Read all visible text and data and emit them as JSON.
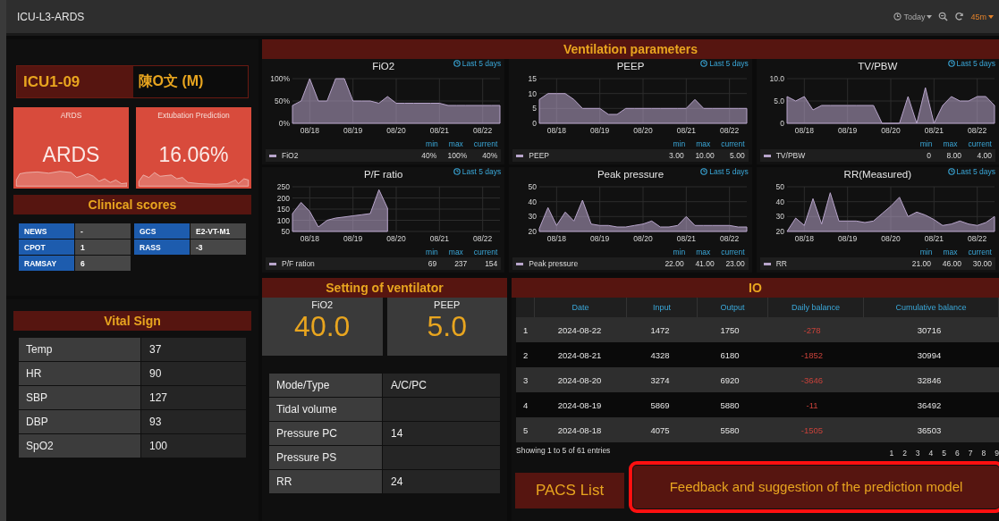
{
  "top_bar": {
    "title": "ICU-L3-ARDS",
    "time_range": "Today",
    "refresh_interval": "45m"
  },
  "patient": {
    "bed": "ICU1-09",
    "name": "陳O文 (M)"
  },
  "prediction_cards": [
    {
      "title": "ARDS",
      "value": "ARDS"
    },
    {
      "title": "Extubation Prediction",
      "value": "16.06%"
    }
  ],
  "clinical_scores": {
    "title": "Clinical scores",
    "items": [
      {
        "label": "NEWS",
        "value": "-"
      },
      {
        "label": "GCS",
        "value": "E2-VT-M1"
      },
      {
        "label": "CPOT",
        "value": "1"
      },
      {
        "label": "RASS",
        "value": "-3"
      },
      {
        "label": "RAMSAY",
        "value": "6"
      }
    ]
  },
  "vital_sign": {
    "title": "Vital Sign",
    "rows": [
      {
        "label": "Temp",
        "value": "37"
      },
      {
        "label": "HR",
        "value": "90"
      },
      {
        "label": "SBP",
        "value": "127"
      },
      {
        "label": "DBP",
        "value": "93"
      },
      {
        "label": "SpO2",
        "value": "100"
      }
    ]
  },
  "ventilation_parameters": {
    "title": "Ventilation parameters",
    "panels": [
      {
        "title": "FiO2",
        "range": "Last 5 days",
        "legend_headers": [
          "min",
          "max",
          "current"
        ],
        "legend": {
          "min": "40%",
          "max": "100%",
          "current": "40%"
        },
        "chart_data": {
          "grid": true,
          "type": "area",
          "categories": [
            null,
            null,
            "08/18",
            null,
            null,
            null,
            null,
            "08/19",
            null,
            null,
            null,
            null,
            "08/20",
            null,
            null,
            null,
            null,
            "08/21",
            null,
            null,
            null,
            null,
            "08/22",
            null,
            null
          ],
          "series": [
            {
              "name": "FiO2",
              "color": "#b9a6cc",
              "values": [
                40,
                50,
                100,
                50,
                50,
                100,
                100,
                50,
                50,
                50,
                45,
                60,
                45,
                45,
                45,
                45,
                45,
                45,
                40,
                40,
                40,
                40,
                40,
                40,
                40
              ]
            }
          ],
          "ylim": [
            0,
            100
          ],
          "yticks": [
            {
              "value": 0,
              "label": "0%"
            },
            {
              "value": 50,
              "label": "50%"
            },
            {
              "value": 100,
              "label": "100%"
            }
          ]
        }
      },
      {
        "title": "PEEP",
        "range": "Last 5 days",
        "legend_headers": [
          "min",
          "max",
          "current"
        ],
        "legend": {
          "min": "3.00",
          "max": "10.00",
          "current": "5.00"
        },
        "chart_data": {
          "grid": true,
          "type": "area",
          "categories": [
            null,
            null,
            "08/18",
            null,
            null,
            null,
            null,
            "08/19",
            null,
            null,
            null,
            null,
            "08/20",
            null,
            null,
            null,
            null,
            "08/21",
            null,
            null,
            null,
            null,
            "08/22",
            null,
            null
          ],
          "series": [
            {
              "name": "PEEP",
              "color": "#b9a6cc",
              "values": [
                8,
                10,
                10,
                10,
                8,
                5,
                5,
                5,
                3,
                3,
                5,
                5,
                5,
                5,
                5,
                5,
                5,
                5,
                8,
                5,
                5,
                5,
                5,
                5,
                5
              ]
            }
          ],
          "ylim": [
            0,
            15
          ],
          "yticks": [
            0,
            5,
            10,
            15
          ]
        }
      },
      {
        "title": "TV/PBW",
        "range": "Last 5 days",
        "legend_headers": [
          "min",
          "max",
          "current"
        ],
        "legend": {
          "min": "0",
          "max": "8.00",
          "current": "4.00"
        },
        "chart_data": {
          "grid": true,
          "type": "area",
          "categories": [
            null,
            null,
            "08/18",
            null,
            null,
            null,
            null,
            "08/19",
            null,
            null,
            null,
            null,
            "08/20",
            null,
            null,
            null,
            null,
            "08/21",
            null,
            null,
            null,
            null,
            "08/22",
            null,
            null
          ],
          "series": [
            {
              "name": "TV/PBW",
              "color": "#b9a6cc",
              "values": [
                6,
                5,
                6,
                3,
                4,
                4,
                4,
                4,
                4,
                4,
                4,
                0,
                0,
                0,
                6,
                0,
                8,
                0,
                4,
                6,
                5,
                5,
                6,
                6,
                4
              ]
            }
          ],
          "ylim": [
            0,
            10
          ],
          "yticks": [
            0,
            {
              "value": 5,
              "label": "5.0"
            },
            {
              "value": 10,
              "label": "10.0"
            }
          ]
        }
      },
      {
        "title": "P/F ratio",
        "range": "Last 5 days",
        "legend_headers": [
          "min",
          "max",
          "current"
        ],
        "legend": {
          "min": "69",
          "max": "237",
          "current": "154"
        },
        "chart_data": {
          "grid": true,
          "type": "area",
          "categories": [
            null,
            null,
            "08/18",
            null,
            null,
            null,
            null,
            "08/19",
            null,
            null,
            null,
            null,
            "08/20",
            null,
            null,
            null,
            null,
            "08/21",
            null,
            null,
            null,
            null,
            "08/22",
            null,
            null
          ],
          "series": [
            {
              "name": "P/F ration",
              "color": "#b9a6cc",
              "values": [
                130,
                180,
                140,
                70,
                100,
                110,
                115,
                120,
                125,
                130,
                237,
                154,
                null,
                null,
                null,
                null,
                null,
                null,
                null,
                null,
                null,
                null,
                null,
                null,
                null
              ]
            }
          ],
          "ylim": [
            50,
            250
          ],
          "yticks": [
            50,
            100,
            150,
            200,
            250
          ]
        }
      },
      {
        "title": "Peak pressure",
        "range": "Last 5 days",
        "legend_headers": [
          "min",
          "max",
          "current"
        ],
        "legend": {
          "min": "22.00",
          "max": "41.00",
          "current": "23.00"
        },
        "chart_data": {
          "grid": true,
          "type": "area",
          "categories": [
            null,
            null,
            "08/18",
            null,
            null,
            null,
            null,
            "08/19",
            null,
            null,
            null,
            null,
            "08/20",
            null,
            null,
            null,
            null,
            "08/21",
            null,
            null,
            null,
            null,
            "08/22",
            null,
            null
          ],
          "series": [
            {
              "name": "Peak pressure",
              "color": "#b9a6cc",
              "values": [
                22,
                36,
                24,
                33,
                27,
                41,
                25,
                24,
                24,
                23,
                23,
                24,
                25,
                27,
                23,
                23,
                24,
                30,
                24,
                24,
                24,
                24,
                24,
                23,
                23
              ]
            }
          ],
          "ylim": [
            20,
            50
          ],
          "yticks": [
            20,
            30,
            40,
            50
          ]
        }
      },
      {
        "title": "RR(Measured)",
        "range": "Last 5 days",
        "legend_headers": [
          "min",
          "max",
          "current"
        ],
        "legend": {
          "min": "21.00",
          "max": "46.00",
          "current": "30.00"
        },
        "chart_data": {
          "grid": true,
          "type": "area",
          "categories": [
            null,
            null,
            "08/18",
            null,
            null,
            null,
            null,
            "08/19",
            null,
            null,
            null,
            null,
            "08/20",
            null,
            null,
            null,
            null,
            "08/21",
            null,
            null,
            null,
            null,
            "08/22",
            null,
            null
          ],
          "series": [
            {
              "name": "RR",
              "color": "#b9a6cc",
              "values": [
                20,
                29,
                24,
                42,
                25,
                46,
                27,
                27,
                27,
                26,
                27,
                32,
                37,
                43,
                30,
                33,
                31,
                28,
                24,
                25,
                27,
                25,
                24,
                26,
                30
              ]
            }
          ],
          "ylim": [
            20,
            50
          ],
          "yticks": [
            20,
            30,
            40,
            50
          ]
        }
      }
    ]
  },
  "ventilator_setting": {
    "title": "Setting of ventilator",
    "big_values": [
      {
        "label": "FiO2",
        "value": "40.0"
      },
      {
        "label": "PEEP",
        "value": "5.0"
      }
    ],
    "rows": [
      {
        "label": "Mode/Type",
        "value": "A/C/PC"
      },
      {
        "label": "Tidal volume"
      },
      {
        "label": "Pressure PC",
        "value": "14"
      },
      {
        "label": "Pressure PS"
      },
      {
        "label": "RR",
        "value": "24"
      }
    ]
  },
  "io": {
    "title": "IO",
    "columns": [
      "Date",
      "Input",
      "Output",
      "Daily balance",
      "Cumulative balance"
    ],
    "rows": [
      {
        "index": "1",
        "cells": [
          "2024-08-22",
          "1472",
          "1750",
          "-278",
          "30716"
        ]
      },
      {
        "index": "2",
        "cells": [
          "2024-08-21",
          "4328",
          "6180",
          "-1852",
          "30994"
        ]
      },
      {
        "index": "3",
        "cells": [
          "2024-08-20",
          "3274",
          "6920",
          "-3646",
          "32846"
        ]
      },
      {
        "index": "4",
        "cells": [
          "2024-08-19",
          "5869",
          "5880",
          "-11",
          "36492"
        ]
      },
      {
        "index": "5",
        "cells": [
          "2024-08-18",
          "4075",
          "5580",
          "-1505",
          "36503"
        ]
      }
    ],
    "summary": "Showing 1 to 5 of 61 entries",
    "pages": [
      "1",
      "2",
      "3",
      "4",
      "5",
      "6",
      "7",
      "8",
      "9"
    ]
  },
  "buttons": [
    {
      "label": "PACS List",
      "highlighted": false
    },
    {
      "label": "Feedback and suggestion of the prediction model",
      "highlighted": true
    }
  ]
}
